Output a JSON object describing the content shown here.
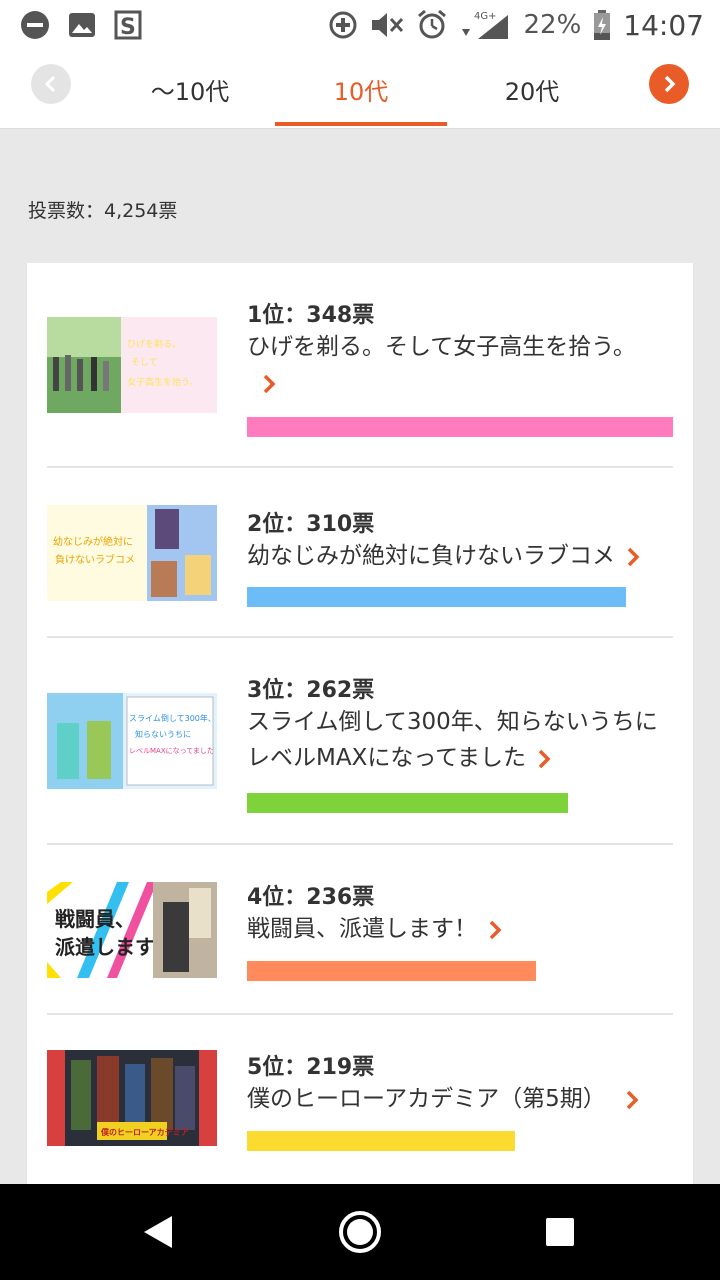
{
  "status_bar": {
    "battery": "22%",
    "time": "14:07",
    "network": "4G+"
  },
  "tabs": {
    "items": [
      {
        "label": "〜10代"
      },
      {
        "label": "10代"
      },
      {
        "label": "20代"
      }
    ],
    "active_index": 1
  },
  "votes_label": "投票数：4,254票",
  "ranking": [
    {
      "rank": "1位：348票",
      "title": "ひげを剃る。そして女子高生を拾う。",
      "votes": 348,
      "color": "#ff7bbd",
      "thumb_text": [
        "ひげを剃る。",
        "そして",
        "女子高生を拾う。"
      ]
    },
    {
      "rank": "2位：310票",
      "title": "幼なじみが絶対に負けないラブコメ",
      "votes": 310,
      "color": "#6bbcf7",
      "thumb_text": [
        "幼なじみが絶対に",
        "負けないラブコメ"
      ]
    },
    {
      "rank": "3位：262票",
      "title_lines": [
        "スライム倒して300年、知らないうちに",
        "レベルMAXになってました"
      ],
      "votes": 262,
      "color": "#7fd33a",
      "thumb_text": [
        "スライム倒して300年、",
        "知らないうちに",
        "レベルMAXになってました"
      ]
    },
    {
      "rank": "4位：236票",
      "title": "戦闘員、派遣します！",
      "votes": 236,
      "color": "#ff8a5c",
      "thumb_text": [
        "戦闘員、",
        "派遣します"
      ]
    },
    {
      "rank": "5位：219票",
      "title": "僕のヒーローアカデミア（第5期）",
      "votes": 219,
      "color": "#fbdb2f",
      "thumb_text": [
        "僕のヒーローアカデミア"
      ]
    }
  ],
  "colors": {
    "accent": "#e95b27",
    "background": "#e8e8e8"
  }
}
